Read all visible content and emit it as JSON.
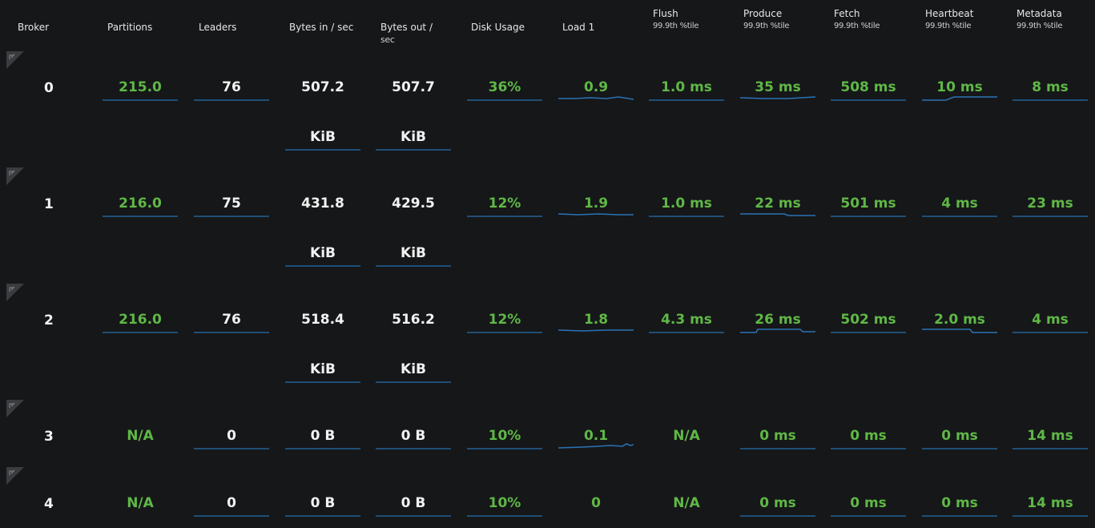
{
  "headers": {
    "broker": "Broker",
    "partitions": "Partitions",
    "leaders": "Leaders",
    "bytes_in": "Bytes in / sec",
    "bytes_out_line1": "Bytes out /",
    "bytes_out_line2": "sec",
    "disk_usage": "Disk Usage",
    "load1": "Load 1",
    "flush": "Flush",
    "produce": "Produce",
    "fetch": "Fetch",
    "heartbeat": "Heartbeat",
    "metadata": "Metadata",
    "percentile": "99.9th %tile"
  },
  "brokers": [
    {
      "id": "0",
      "partitions": "215.0",
      "leaders": "76",
      "bytes_in": "507.2",
      "bytes_in_unit": "KiB",
      "bytes_out": "507.7",
      "bytes_out_unit": "KiB",
      "disk": "36%",
      "load": "0.9",
      "flush": "1.0 ms",
      "produce": "35 ms",
      "fetch": "508 ms",
      "heartbeat": "10 ms",
      "metadata": "8 ms"
    },
    {
      "id": "1",
      "partitions": "216.0",
      "leaders": "75",
      "bytes_in": "431.8",
      "bytes_in_unit": "KiB",
      "bytes_out": "429.5",
      "bytes_out_unit": "KiB",
      "disk": "12%",
      "load": "1.9",
      "flush": "1.0 ms",
      "produce": "22 ms",
      "fetch": "501 ms",
      "heartbeat": "4 ms",
      "metadata": "23 ms"
    },
    {
      "id": "2",
      "partitions": "216.0",
      "leaders": "76",
      "bytes_in": "518.4",
      "bytes_in_unit": "KiB",
      "bytes_out": "516.2",
      "bytes_out_unit": "KiB",
      "disk": "12%",
      "load": "1.8",
      "flush": "4.3 ms",
      "produce": "26 ms",
      "fetch": "502 ms",
      "heartbeat": "2.0 ms",
      "metadata": "4 ms"
    },
    {
      "id": "3",
      "partitions": "N/A",
      "leaders": "0",
      "bytes_in": "0 B",
      "bytes_in_unit": "",
      "bytes_out": "0 B",
      "bytes_out_unit": "",
      "disk": "10%",
      "load": "0.1",
      "flush": "N/A",
      "produce": "0 ms",
      "fetch": "0 ms",
      "heartbeat": "0 ms",
      "metadata": "14 ms"
    },
    {
      "id": "4",
      "partitions": "N/A",
      "leaders": "0",
      "bytes_in": "0 B",
      "bytes_in_unit": "",
      "bytes_out": "0 B",
      "bytes_out_unit": "",
      "disk": "10%",
      "load": "0",
      "flush": "N/A",
      "produce": "0 ms",
      "fetch": "0 ms",
      "heartbeat": "0 ms",
      "metadata": "14 ms"
    }
  ],
  "icons": {
    "row_link": "external-link-icon"
  },
  "colors": {
    "good": "#5fb846",
    "neutral": "#f2f2f2",
    "sparkline": "#2a73b4",
    "background": "#161719"
  }
}
